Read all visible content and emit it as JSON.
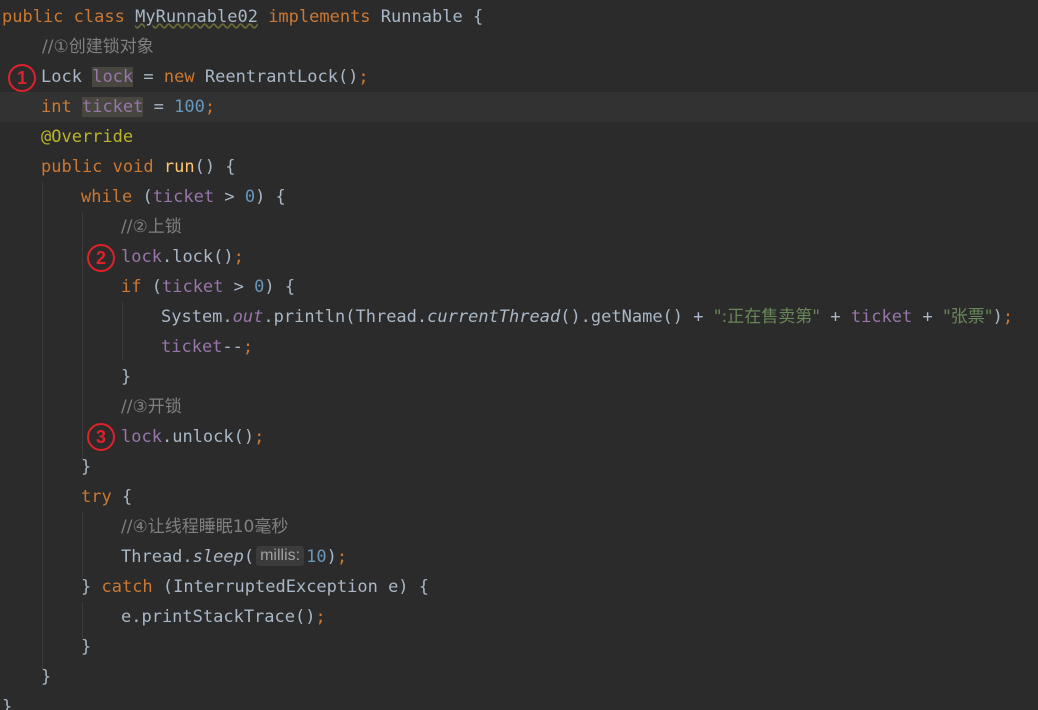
{
  "code": {
    "l1": {
      "kw_public": "public",
      "kw_class": "class",
      "class_name": "MyRunnable02",
      "kw_implements": "implements",
      "iface": "Runnable",
      "brace": "{"
    },
    "l2": {
      "comment": "//①创建锁对象"
    },
    "l3": {
      "type": "Lock",
      "var": "lock",
      "eq": "=",
      "kw_new": "new",
      "ctor": "ReentrantLock",
      "parens": "()",
      "semi": ";"
    },
    "l4": {
      "type": "int",
      "var": "ticket",
      "eq": "=",
      "num": "100",
      "semi": ";"
    },
    "l5": {
      "annotation": "@Override"
    },
    "l6": {
      "kw_public": "public",
      "kw_void": "void",
      "method": "run",
      "rest": "() {"
    },
    "l7": {
      "kw_while": "while",
      "open": "(",
      "var": "ticket",
      "op": " > ",
      "num": "0",
      "close": ") {"
    },
    "l8": {
      "comment": "//②上锁"
    },
    "l9": {
      "obj": "lock",
      "dot": ".",
      "call": "lock()",
      "semi": ";"
    },
    "l10": {
      "kw_if": "if",
      "open": "(",
      "var": "ticket",
      "op": " > ",
      "num": "0",
      "close": ") {"
    },
    "l11": {
      "sys": "System.",
      "out": "out",
      "println": ".println(Thread.",
      "current": "currentThread",
      "getname": "().getName() + ",
      "str1": "\":正在售卖第\"",
      "plus1": " + ",
      "var": "ticket",
      "plus2": " + ",
      "str2": "\"张票\"",
      "close": ")",
      "semi": ";"
    },
    "l12": {
      "var": "ticket",
      "op": "--",
      "semi": ";"
    },
    "l13": {
      "brace": "}"
    },
    "l14": {
      "comment": "//③开锁"
    },
    "l15": {
      "obj": "lock",
      "dot": ".",
      "call": "unlock()",
      "semi": ";"
    },
    "l16": {
      "brace": "}"
    },
    "l17": {
      "kw_try": "try",
      "brace": " {"
    },
    "l18": {
      "comment": "//④让线程睡眠10毫秒"
    },
    "l19": {
      "obj": "Thread.",
      "sleep": "sleep",
      "open": "(",
      "hint": "millis:",
      "num": "10",
      "close": ")",
      "semi": ";"
    },
    "l20": {
      "brace_open": "} ",
      "kw_catch": "catch",
      "rest": " (InterruptedException e) {"
    },
    "l21": {
      "call": "e.printStackTrace()",
      "semi": ";"
    },
    "l22": {
      "brace": "}"
    },
    "l23": {
      "brace": "}"
    },
    "l24": {
      "brace": "}"
    }
  },
  "markers": {
    "m1": "1",
    "m2": "2",
    "m3": "3"
  },
  "colors": {
    "background": "#2b2b2b",
    "keyword": "#cc7832",
    "string": "#6a8759",
    "number": "#6897bb",
    "field": "#9876aa",
    "comment": "#808080",
    "annotation": "#bbb529",
    "method": "#ffc66d",
    "marker": "#e0202a"
  }
}
